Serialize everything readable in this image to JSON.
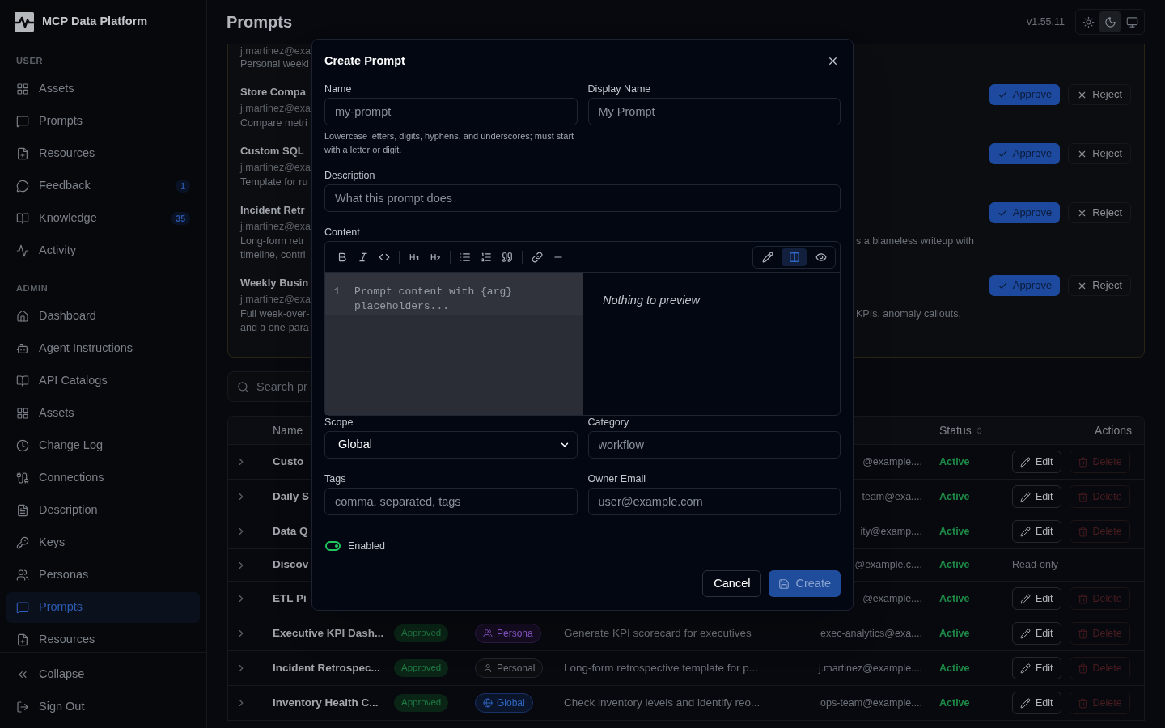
{
  "sidebar": {
    "brand": "MCP Data Platform",
    "sections": [
      {
        "title": "USER",
        "items": [
          {
            "label": "Assets",
            "selected": false
          },
          {
            "label": "Prompts",
            "selected": false
          },
          {
            "label": "Resources",
            "selected": false
          },
          {
            "label": "Feedback",
            "selected": false,
            "badge": "1"
          },
          {
            "label": "Knowledge",
            "selected": false,
            "badge": "35"
          },
          {
            "label": "Activity",
            "selected": false
          }
        ]
      },
      {
        "title": "ADMIN",
        "items": [
          {
            "label": "Dashboard",
            "selected": false
          },
          {
            "label": "Agent Instructions",
            "selected": false
          },
          {
            "label": "API Catalogs",
            "selected": false
          },
          {
            "label": "Assets",
            "selected": false
          },
          {
            "label": "Change Log",
            "selected": false
          },
          {
            "label": "Connections",
            "selected": false
          },
          {
            "label": "Description",
            "selected": false
          },
          {
            "label": "Keys",
            "selected": false
          },
          {
            "label": "Personas",
            "selected": false
          },
          {
            "label": "Prompts",
            "selected": true
          },
          {
            "label": "Resources",
            "selected": false
          }
        ]
      }
    ],
    "footer": [
      {
        "label": "Collapse"
      },
      {
        "label": "Sign Out"
      }
    ]
  },
  "header": {
    "title": "Prompts",
    "version": "v1.55.11",
    "theme_options": [
      {
        "selected": false
      },
      {
        "selected": true
      },
      {
        "selected": false
      }
    ]
  },
  "pending_review": {
    "items": [
      {
        "owner": "j.martinez@exa",
        "description": [
          "Personal weekl"
        ]
      },
      {
        "title": "Store Compa",
        "owner": "j.martinez@exa",
        "description": [
          "Compare metri"
        ],
        "actions": [
          {
            "kind": "approve",
            "label": "Approve"
          },
          {
            "kind": "reject",
            "label": "Reject"
          }
        ]
      },
      {
        "title": "Custom SQL",
        "owner": "j.martinez@exa",
        "description": [
          "Template for ru"
        ],
        "actions": [
          {
            "kind": "approve",
            "label": "Approve"
          },
          {
            "kind": "reject",
            "label": "Reject"
          }
        ]
      },
      {
        "title": "Incident Retr",
        "owner": "j.martinez@exa",
        "description": [
          "Long-form retr",
          "timeline, contri"
        ],
        "description_tail": "s a blameless writeup with",
        "actions": [
          {
            "kind": "approve",
            "label": "Approve"
          },
          {
            "kind": "reject",
            "label": "Reject"
          }
        ]
      },
      {
        "title": "Weekly Busin",
        "owner": "j.martinez@exa",
        "description": [
          "Full week-over-",
          "and a one-para"
        ],
        "description_tail": "KPIs, anomaly callouts,",
        "actions": [
          {
            "kind": "approve",
            "label": "Approve"
          },
          {
            "kind": "reject",
            "label": "Reject"
          }
        ]
      }
    ]
  },
  "search": {
    "placeholder": "Search pr"
  },
  "table": {
    "columns": [
      {
        "label": "Name",
        "sortable": false
      },
      {
        "label": "Status",
        "sortable": true
      },
      {
        "label": "Actions",
        "sortable": false
      }
    ],
    "rows": [
      {
        "expanded": false,
        "name": "Custo",
        "owner": "@example....",
        "status": "Active",
        "actions": [
          {
            "kind": "edit",
            "label": "Edit",
            "disabled": false
          },
          {
            "kind": "delete",
            "label": "Delete",
            "disabled": true
          }
        ]
      },
      {
        "expanded": false,
        "name": "Daily S",
        "owner": "team@exa....",
        "status": "Active",
        "actions": [
          {
            "kind": "edit",
            "label": "Edit",
            "disabled": false
          },
          {
            "kind": "delete",
            "label": "Delete",
            "disabled": true
          }
        ]
      },
      {
        "expanded": false,
        "name": "Data Q",
        "owner": "ity@examp....",
        "status": "Active",
        "actions": [
          {
            "kind": "edit",
            "label": "Edit",
            "disabled": false
          },
          {
            "kind": "delete",
            "label": "Delete",
            "disabled": true
          }
        ]
      },
      {
        "expanded": false,
        "name": "Discov",
        "owner": "@example.c....",
        "status": "Active",
        "note": "Read-only"
      },
      {
        "expanded": false,
        "name": "ETL Pi",
        "owner": "@example....",
        "status": "Active",
        "actions": [
          {
            "kind": "edit",
            "label": "Edit",
            "disabled": false
          },
          {
            "kind": "delete",
            "label": "Delete",
            "disabled": true
          }
        ]
      },
      {
        "expanded": false,
        "name": "Executive KPI Dash...",
        "approval": "Approved",
        "scope": {
          "kind": "persona",
          "label": "Persona"
        },
        "description": "Generate KPI scorecard for executives",
        "owner": "exec-analytics@exa....",
        "status": "Active",
        "actions": [
          {
            "kind": "edit",
            "label": "Edit",
            "disabled": false
          },
          {
            "kind": "delete",
            "label": "Delete",
            "disabled": true
          }
        ]
      },
      {
        "expanded": false,
        "name": "Incident Retrospec...",
        "approval": "Approved",
        "scope": {
          "kind": "personal",
          "label": "Personal"
        },
        "description": "Long-form retrospective template for p...",
        "owner": "j.martinez@example....",
        "status": "Active",
        "actions": [
          {
            "kind": "edit",
            "label": "Edit",
            "disabled": false
          },
          {
            "kind": "delete",
            "label": "Delete",
            "disabled": true
          }
        ]
      },
      {
        "expanded": false,
        "name": "Inventory Health C...",
        "approval": "Approved",
        "scope": {
          "kind": "global",
          "label": "Global"
        },
        "description": "Check inventory levels and identify reo...",
        "owner": "ops-team@example....",
        "status": "Active",
        "actions": [
          {
            "kind": "edit",
            "label": "Edit",
            "disabled": false
          },
          {
            "kind": "delete",
            "label": "Delete",
            "disabled": true
          }
        ]
      }
    ]
  },
  "dialog": {
    "title": "Create Prompt",
    "name": {
      "label": "Name",
      "placeholder": "my-prompt",
      "hint": "Lowercase letters, digits, hyphens, and underscores; must start with a letter or digit."
    },
    "display_name": {
      "label": "Display Name",
      "placeholder": "My Prompt"
    },
    "description": {
      "label": "Description",
      "placeholder": "What this prompt does"
    },
    "content": {
      "label": "Content",
      "view_modes": [
        {
          "selected": false
        },
        {
          "selected": true
        },
        {
          "selected": false
        }
      ],
      "line_number": "1",
      "placeholder": "Prompt content with {arg} placeholders...",
      "preview": "Nothing to preview"
    },
    "scope": {
      "label": "Scope",
      "value": "Global"
    },
    "category": {
      "label": "Category",
      "placeholder": "workflow"
    },
    "tags": {
      "label": "Tags",
      "placeholder": "comma, separated, tags"
    },
    "owner_email": {
      "label": "Owner Email",
      "placeholder": "user@example.com"
    },
    "enabled": {
      "label": "Enabled",
      "on": true
    },
    "buttons": [
      {
        "kind": "cancel",
        "label": "Cancel",
        "disabled": false
      },
      {
        "kind": "create",
        "label": "Create",
        "disabled": true
      }
    ]
  }
}
